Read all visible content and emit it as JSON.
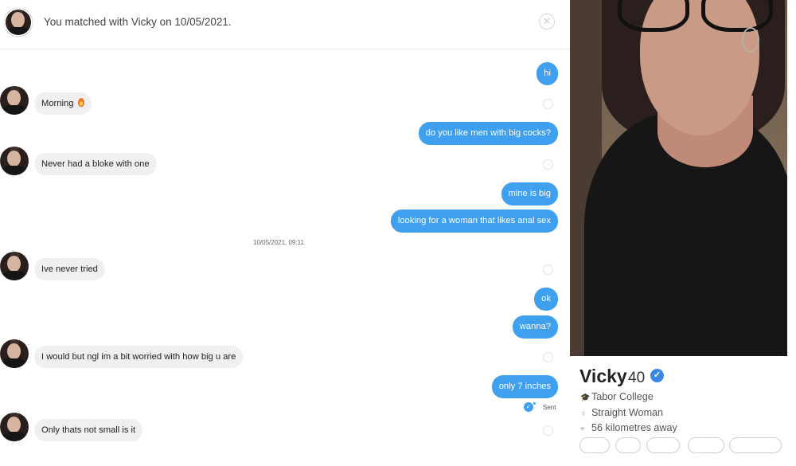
{
  "header": {
    "match_text": "You matched with Vicky on 10/05/2021."
  },
  "messages": [
    {
      "side": "out",
      "text": "hi"
    },
    {
      "side": "in",
      "text": "Morning"
    },
    {
      "side": "out",
      "text": "do you like men with big cocks?"
    },
    {
      "side": "in",
      "text": "Never had a bloke with one"
    },
    {
      "side": "out",
      "text": "mine is big"
    },
    {
      "side": "out",
      "text": "looking for a woman that likes anal sex"
    },
    {
      "side": "in",
      "text": "Ive never tried"
    },
    {
      "side": "out",
      "text": "ok"
    },
    {
      "side": "out",
      "text": "wanna?"
    },
    {
      "side": "in",
      "text": "I would but ngl im a bit worried with how big u are"
    },
    {
      "side": "out",
      "text": "only 7 inches"
    },
    {
      "side": "in",
      "text": "Only thats not small is it"
    }
  ],
  "timestamp": "10/05/2021, 09:11",
  "sent_label": "Sent",
  "profile": {
    "name": "Vicky",
    "age": "40",
    "school": "Tabor College",
    "orientation": "Straight Woman",
    "distance": "56 kilometres away"
  },
  "icons": {
    "close": "close-icon",
    "flame": "flame-emoji",
    "verified": "verified-badge-icon",
    "school": "graduation-cap-icon",
    "person": "person-icon",
    "location": "location-pin-icon"
  },
  "colors": {
    "outgoing_bubble": "#3fa0f0",
    "incoming_bubble": "#f0f0f0",
    "verified": "#3a87e6"
  }
}
